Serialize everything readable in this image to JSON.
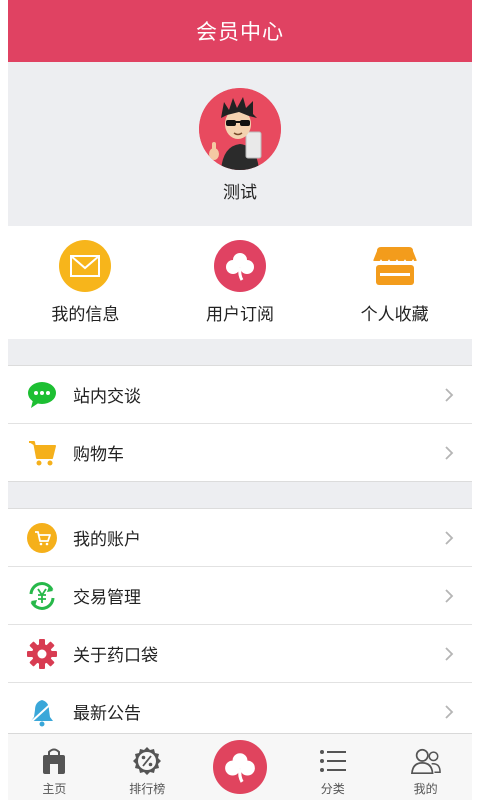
{
  "header": {
    "title": "会员中心"
  },
  "profile": {
    "username": "测试"
  },
  "quick_actions": [
    {
      "label": "我的信息",
      "icon": "envelope-icon",
      "color": "#f7b51b"
    },
    {
      "label": "用户订阅",
      "icon": "clover-icon",
      "color": "#e04262"
    },
    {
      "label": "个人收藏",
      "icon": "store-icon",
      "color": "#f39c1c"
    }
  ],
  "group1": [
    {
      "label": "站内交谈",
      "icon": "chat-bubble-icon",
      "color": "#1dbf32"
    },
    {
      "label": "购物车",
      "icon": "shopping-cart-icon",
      "color": "#f5b01b"
    }
  ],
  "group2": [
    {
      "label": "我的账户",
      "icon": "account-cart-icon",
      "color": "#f5b01b"
    },
    {
      "label": "交易管理",
      "icon": "yuan-exchange-icon",
      "color": "#27b84a"
    },
    {
      "label": "关于药口袋",
      "icon": "gear-icon",
      "color": "#d83c52"
    },
    {
      "label": "最新公告",
      "icon": "bell-icon",
      "color": "#3aa7d9"
    }
  ],
  "tabbar": [
    {
      "label": "主页",
      "icon": "home-bag-icon"
    },
    {
      "label": "排行榜",
      "icon": "percent-badge-icon"
    },
    {
      "label": "",
      "icon": "clover-icon"
    },
    {
      "label": "分类",
      "icon": "list-icon"
    },
    {
      "label": "我的",
      "icon": "users-icon"
    }
  ],
  "colors": {
    "brand": "#e04262",
    "background": "#edeef1"
  }
}
